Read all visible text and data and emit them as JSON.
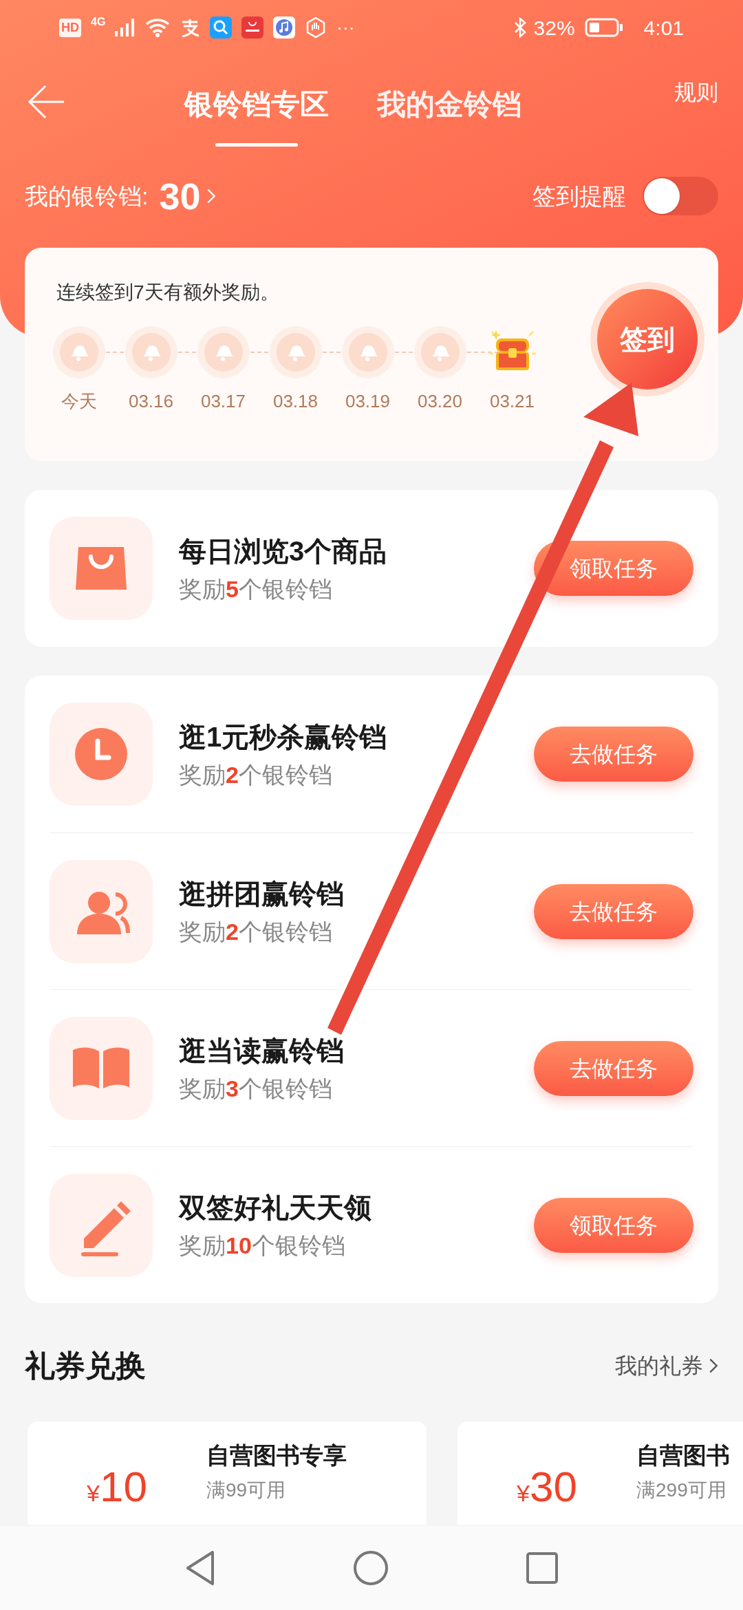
{
  "status_bar": {
    "hd": "HD",
    "network": "4G",
    "more": "···",
    "battery": "32%",
    "time": "4:01"
  },
  "header": {
    "tabs": [
      {
        "label": "银铃铛专区",
        "selected": true
      },
      {
        "label": "我的金铃铛",
        "selected": false
      }
    ],
    "rules_link": "规则"
  },
  "balance": {
    "label": "我的银铃铛:",
    "value": "30"
  },
  "reminder": {
    "label": "签到提醒",
    "on": false
  },
  "checkin": {
    "note": "连续签到7天有额外奖励。",
    "button": "签到",
    "days": [
      {
        "label": "今天",
        "kind": "bell"
      },
      {
        "label": "03.16",
        "kind": "bell"
      },
      {
        "label": "03.17",
        "kind": "bell"
      },
      {
        "label": "03.18",
        "kind": "bell"
      },
      {
        "label": "03.19",
        "kind": "bell"
      },
      {
        "label": "03.20",
        "kind": "bell"
      },
      {
        "label": "03.21",
        "kind": "chest"
      }
    ]
  },
  "task_cards": [
    {
      "tasks": [
        {
          "kind": "bag",
          "title": "每日浏览3个商品",
          "reward": "奖励**5**个银铃铛",
          "button": "领取任务"
        }
      ]
    },
    {
      "tasks": [
        {
          "kind": "clock",
          "title": "逛1元秒杀赢铃铛",
          "reward": "奖励**2**个银铃铛",
          "button": "去做任务"
        },
        {
          "kind": "people",
          "title": "逛拼团赢铃铛",
          "reward": "奖励**2**个银铃铛",
          "button": "去做任务"
        },
        {
          "kind": "book",
          "title": "逛当读赢铃铛",
          "reward": "奖励**3**个银铃铛",
          "button": "去做任务"
        },
        {
          "kind": "pencil",
          "title": "双签好礼天天领",
          "reward": "奖励**10**个银铃铛",
          "button": "领取任务"
        }
      ]
    }
  ],
  "coupons": {
    "title": "礼券兑换",
    "link": "我的礼券",
    "items": [
      {
        "currency": "¥",
        "amount": "10",
        "title": "自营图书专享",
        "condition": "满99可用"
      },
      {
        "currency": "¥",
        "amount": "30",
        "title": "自营图书",
        "condition": "满299可用"
      }
    ]
  }
}
